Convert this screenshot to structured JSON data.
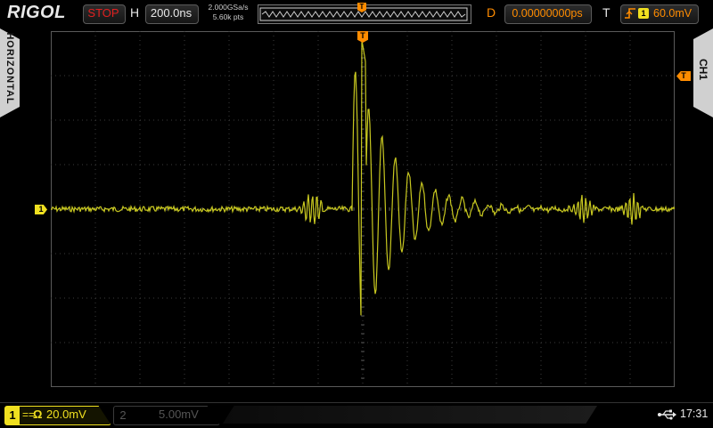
{
  "header": {
    "logo": "RIGOL",
    "run_status": "STOP",
    "h_label": "H",
    "timebase": "200.0ns",
    "sample_rate": "2.000GSa/s",
    "memory_depth": "5.60k pts",
    "d_label": "D",
    "delay": "0.00000000ps",
    "t_label": "T",
    "trigger_source": "1",
    "trigger_level": "60.0mV"
  },
  "side": {
    "left_tab": "HORIZONTAL",
    "right_tab": "CH1"
  },
  "markers": {
    "ch1": "1",
    "trigger": "T"
  },
  "footer": {
    "ch1_num": "1",
    "ch1_coupling": "==",
    "ch1_impedance": "Ω",
    "ch1_scale": "20.0mV",
    "ch2_num": "2",
    "ch2_scale": "5.00mV",
    "clock": "17:31"
  },
  "colors": {
    "trace": "#c8c820",
    "ch1": "#f0e020",
    "trigger": "#ff8c00",
    "grid": "#3c3c3c",
    "stop": "#e02020"
  },
  "icons": [
    "trigger-rising-slope-icon",
    "usb-icon"
  ]
}
